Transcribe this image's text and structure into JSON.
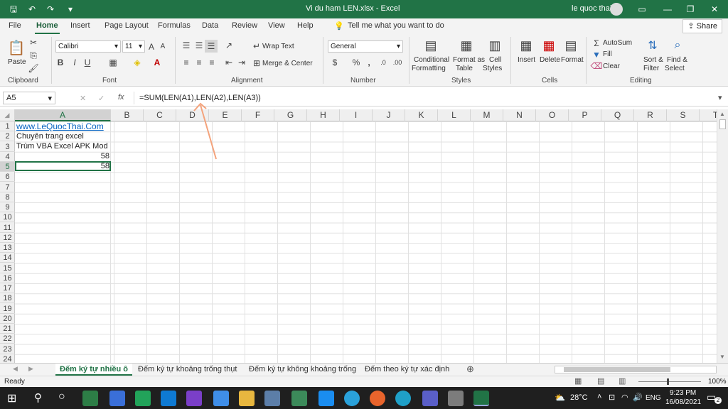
{
  "titlebar": {
    "filename": "Vi du ham LEN.xlsx  -  Excel",
    "user": "le quoc thai"
  },
  "tabs": [
    "File",
    "Home",
    "Insert",
    "Page Layout",
    "Formulas",
    "Data",
    "Review",
    "View",
    "Help"
  ],
  "tell_me": "Tell me what you want to do",
  "share": "Share",
  "ribbon": {
    "paste": "Paste",
    "font_name": "Calibri",
    "font_size": "11",
    "wrap_text": "Wrap Text",
    "merge_center": "Merge & Center",
    "number_format": "General",
    "conditional_formatting": [
      "Conditional",
      "Formatting"
    ],
    "format_as_table": [
      "Format as",
      "Table"
    ],
    "cell_styles": [
      "Cell",
      "Styles"
    ],
    "insert": "Insert",
    "delete": "Delete",
    "format": "Format",
    "autosum": "AutoSum",
    "fill": "Fill",
    "clear": "Clear",
    "sort_filter": [
      "Sort &",
      "Filter"
    ],
    "find_select": [
      "Find &",
      "Select"
    ],
    "groups": [
      "Clipboard",
      "Font",
      "Alignment",
      "Number",
      "Styles",
      "Cells",
      "Editing"
    ],
    "bold": "B",
    "italic": "I",
    "underline": "U"
  },
  "formula_bar": {
    "name_box": "A5",
    "fx": "fx",
    "formula": "=SUM(LEN(A1),LEN(A2),LEN(A3))"
  },
  "columns": [
    "A",
    "B",
    "C",
    "D",
    "E",
    "F",
    "G",
    "H",
    "I",
    "J",
    "K",
    "L",
    "M",
    "N",
    "O",
    "P",
    "Q",
    "R",
    "S",
    "T"
  ],
  "rows": [
    "1",
    "2",
    "3",
    "4",
    "5",
    "6",
    "7",
    "8",
    "9",
    "10",
    "11",
    "12",
    "13",
    "14",
    "15",
    "16",
    "17",
    "18",
    "19",
    "20",
    "21",
    "22",
    "23",
    "24"
  ],
  "cells": {
    "A1": "www.LeQuocThai.Com",
    "A2": "Chuyên trang excel",
    "A3": "Trùm VBA Excel APK Mod",
    "A4": "58",
    "A5": "58"
  },
  "sheets": [
    "Đếm ký tự nhiều ô",
    "Đếm ký tự khoảng trống thụt",
    "Đếm ký tự không khoảng trống",
    "Đếm theo ký tự xác định"
  ],
  "status": {
    "ready": "Ready",
    "zoom": "100%"
  },
  "taskbar": {
    "weather": "28°C",
    "lang": "ENG",
    "time": "9:23 PM",
    "date": "16/08/2021",
    "notif": "2"
  },
  "colors": {
    "accent": "#217346",
    "link": "#0563c1",
    "arrow": "#f4a37c"
  }
}
